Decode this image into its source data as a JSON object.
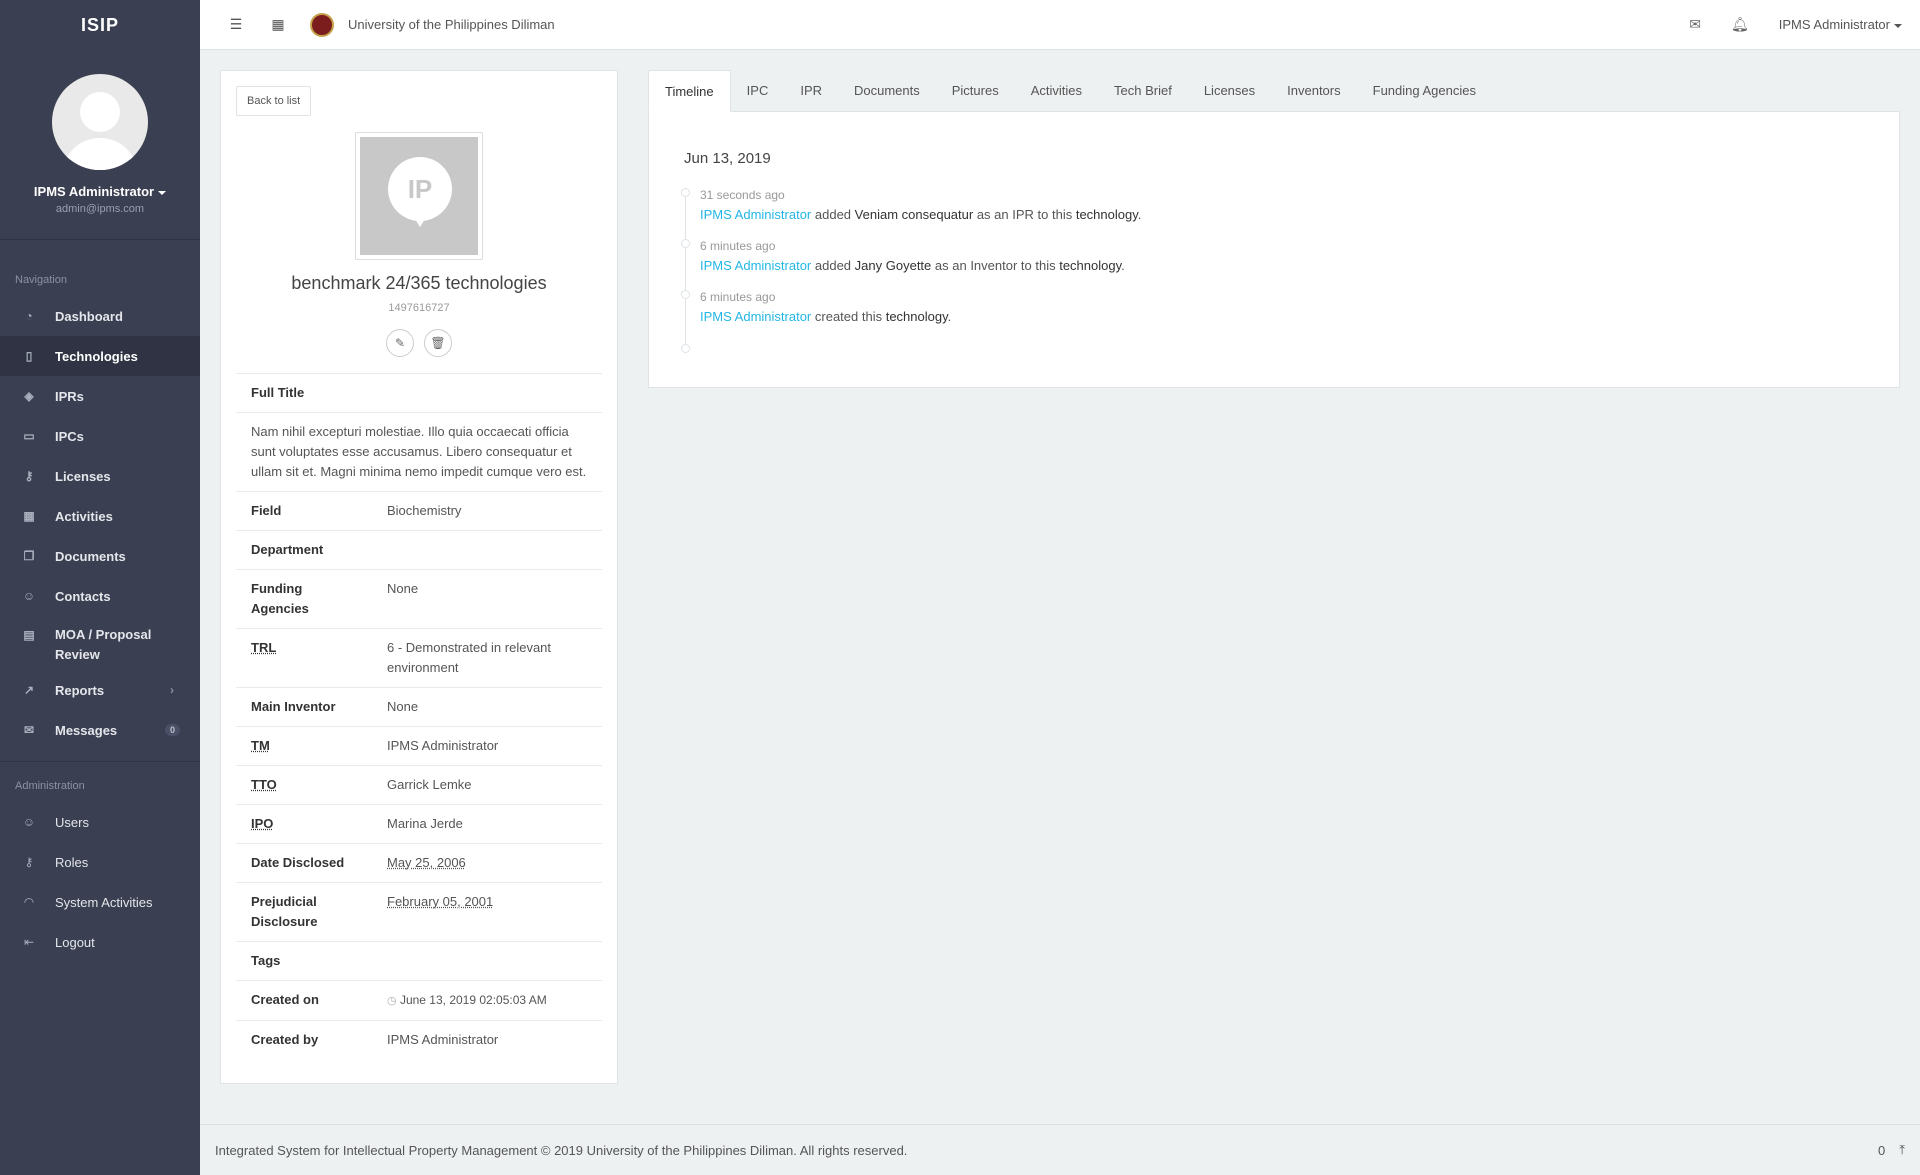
{
  "brand": "ISIP",
  "profile": {
    "name": "IPMS Administrator",
    "email": "admin@ipms.com"
  },
  "nav": {
    "heading": "Navigation",
    "items": [
      {
        "label": "Dashboard",
        "icon": "dashboard-icon"
      },
      {
        "label": "Technologies",
        "icon": "book-icon",
        "active": true
      },
      {
        "label": "IPRs",
        "icon": "layers-icon"
      },
      {
        "label": "IPCs",
        "icon": "folder-icon"
      },
      {
        "label": "Licenses",
        "icon": "key-icon"
      },
      {
        "label": "Activities",
        "icon": "calendar-icon"
      },
      {
        "label": "Documents",
        "icon": "docs-icon"
      },
      {
        "label": "Contacts",
        "icon": "contacts-icon"
      },
      {
        "label": "MOA / Proposal Review",
        "icon": "notebook-icon"
      },
      {
        "label": "Reports",
        "icon": "graph-icon"
      },
      {
        "label": "Messages",
        "icon": "envelope-icon",
        "badge": "0"
      }
    ]
  },
  "admin_nav": {
    "heading": "Administration",
    "items": [
      {
        "label": "Users",
        "icon": "user-icon"
      },
      {
        "label": "Roles",
        "icon": "key-icon"
      },
      {
        "label": "System Activities",
        "icon": "feed-icon"
      },
      {
        "label": "Logout",
        "icon": "logout-icon"
      }
    ]
  },
  "topbar": {
    "university": "University of the Philippines Diliman",
    "user": "IPMS Administrator"
  },
  "tech": {
    "back_label": "Back to list",
    "logo_text": "IP",
    "title": "benchmark 24/365 technologies",
    "id": "1497616727",
    "full_title_label": "Full Title",
    "full_title": "Nam nihil excepturi molestiae. Illo quia occaecati officia sunt voluptates esse accusamus. Libero consequatur et ullam sit et. Magni minima nemo impedit cumque vero est.",
    "fields": {
      "field_label": "Field",
      "field": "Biochemistry",
      "department_label": "Department",
      "department": "",
      "funding_label": "Funding Agencies",
      "funding": "None",
      "trl_label": "TRL",
      "trl": "6 - Demonstrated in relevant environment",
      "main_inventor_label": "Main Inventor",
      "main_inventor": "None",
      "tm_label": "TM",
      "tm": "IPMS Administrator",
      "tto_label": "TTO",
      "tto": "Garrick Lemke",
      "ipo_label": "IPO",
      "ipo": "Marina Jerde",
      "date_disclosed_label": "Date Disclosed",
      "date_disclosed": "May 25, 2006",
      "prejudicial_label": "Prejudicial Disclosure",
      "prejudicial": "February 05, 2001",
      "tags_label": "Tags",
      "tags": "",
      "created_on_label": "Created on",
      "created_on": "June 13, 2019 02:05:03 AM",
      "created_by_label": "Created by",
      "created_by": "IPMS Administrator"
    }
  },
  "tabs": [
    "Timeline",
    "IPC",
    "IPR",
    "Documents",
    "Pictures",
    "Activities",
    "Tech Brief",
    "Licenses",
    "Inventors",
    "Funding Agencies"
  ],
  "timeline": {
    "date": "Jun 13, 2019",
    "entries": [
      {
        "time": "31 seconds ago",
        "actor": "IPMS Administrator",
        "verb": "added",
        "object": "Veniam consequatur",
        "rest": "as an IPR to this",
        "target": "technology"
      },
      {
        "time": "6 minutes ago",
        "actor": "IPMS Administrator",
        "verb": "added",
        "object": "Jany Goyette",
        "rest": "as an Inventor to this",
        "target": "technology"
      },
      {
        "time": "6 minutes ago",
        "actor": "IPMS Administrator",
        "verb": "created this",
        "object": "",
        "rest": "",
        "target": "technology"
      }
    ]
  },
  "footer": {
    "text": "Integrated System for Intellectual Property Management © 2019 University of the Philippines Diliman. All rights reserved.",
    "count": "0"
  },
  "colors": {
    "sidebar": "#3a3f51",
    "link": "#23b7e5",
    "background": "#eef1f2"
  }
}
